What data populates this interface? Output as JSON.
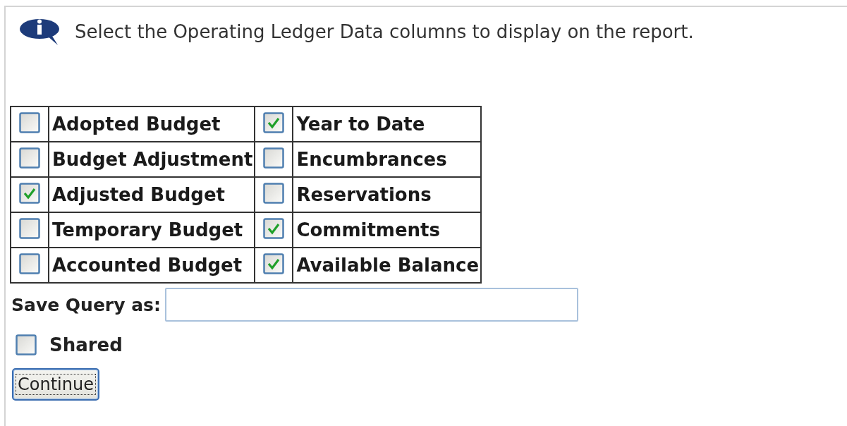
{
  "instruction": {
    "text": "Select the Operating Ledger Data columns to display on the report."
  },
  "column_options": {
    "rows": [
      [
        {
          "label": "Adopted Budget",
          "checked": false
        },
        {
          "label": "Year to Date",
          "checked": true
        }
      ],
      [
        {
          "label": "Budget Adjustment",
          "checked": false
        },
        {
          "label": "Encumbrances",
          "checked": false
        }
      ],
      [
        {
          "label": "Adjusted Budget",
          "checked": true
        },
        {
          "label": "Reservations",
          "checked": false
        }
      ],
      [
        {
          "label": "Temporary Budget",
          "checked": false
        },
        {
          "label": "Commitments",
          "checked": true
        }
      ],
      [
        {
          "label": "Accounted Budget",
          "checked": false
        },
        {
          "label": "Available Balance",
          "checked": true
        }
      ]
    ]
  },
  "save_query": {
    "label": "Save Query as:"
  },
  "shared": {
    "label": "Shared",
    "checked": false
  },
  "buttons": [
    {
      "label": "Continue",
      "focused": true
    }
  ]
}
